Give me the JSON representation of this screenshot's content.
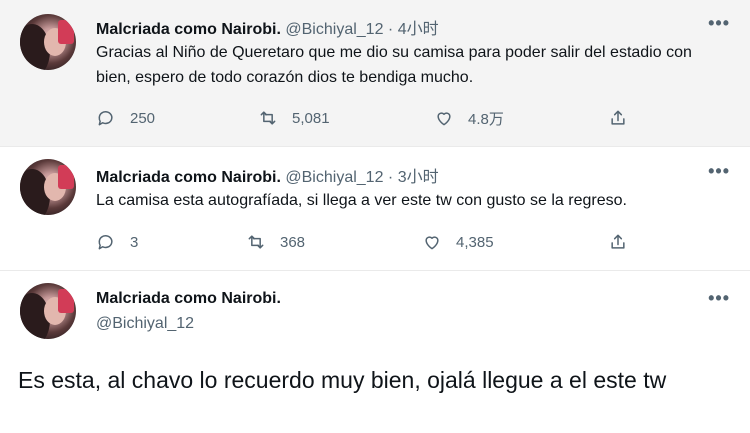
{
  "tweets": [
    {
      "name": "Malcriada como Nairobi.",
      "handle": "@Bichiyal_12",
      "time": "· 4小时",
      "text": "Gracias al Niño de Queretaro que me dio su camisa para poder salir del estadio con bien, espero de todo corazón dios te bendiga mucho.",
      "replies": "250",
      "retweets": "5,081",
      "likes": "4.8万"
    },
    {
      "name": "Malcriada como Nairobi.",
      "handle": "@Bichiyal_12",
      "time": "· 3小时",
      "text": "La camisa esta autografíada, si llega a ver este tw con gusto se la regreso.",
      "replies": "3",
      "retweets": "368",
      "likes": "4,385"
    },
    {
      "name": "Malcriada como Nairobi.",
      "handle": "@Bichiyal_12",
      "text": "Es esta, al chavo lo recuerdo muy bien, ojalá llegue a el este tw"
    }
  ],
  "more_label": "•••",
  "icons": [
    "reply-icon",
    "retweet-icon",
    "like-icon",
    "share-icon",
    "more-icon"
  ],
  "colors": {
    "text": "#0f1419",
    "secondary": "#536471",
    "highlight_bg": "#f4f4f4",
    "thread_line": "#cfd9de"
  }
}
